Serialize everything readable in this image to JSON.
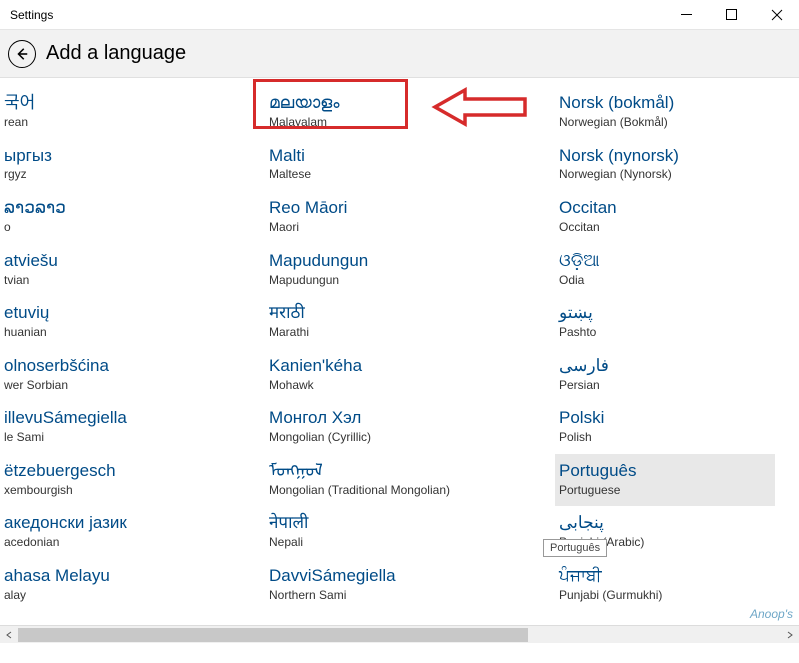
{
  "window": {
    "title": "Settings"
  },
  "header": {
    "page_title": "Add a language"
  },
  "tooltip": "Português",
  "watermark": "Anoop's",
  "columns": {
    "col1": [
      {
        "native": "국어",
        "english": "rean"
      },
      {
        "native": "ыргыз",
        "english": "rgyz"
      },
      {
        "native": "ລາວລາວ",
        "english": "o"
      },
      {
        "native": "atviešu",
        "english": "tvian"
      },
      {
        "native": "etuvių",
        "english": "huanian"
      },
      {
        "native": "olnoserbšćina",
        "english": "wer Sorbian"
      },
      {
        "native": "illevuSámegiella",
        "english": "le Sami"
      },
      {
        "native": "ëtzebuergesch",
        "english": "xembourgish"
      },
      {
        "native": "акедонски јазик",
        "english": "acedonian"
      },
      {
        "native": "ahasa Melayu",
        "english": "alay"
      }
    ],
    "col2": [
      {
        "native": "മലയാളം",
        "english": "Malayalam"
      },
      {
        "native": "Malti",
        "english": "Maltese"
      },
      {
        "native": "Reo Māori",
        "english": "Maori"
      },
      {
        "native": "Mapudungun",
        "english": "Mapudungun"
      },
      {
        "native": "मराठी",
        "english": "Marathi"
      },
      {
        "native": "Kanien'kéha",
        "english": "Mohawk"
      },
      {
        "native": "Монгол Хэл",
        "english": "Mongolian (Cyrillic)"
      },
      {
        "native": "ᠮᠣᠩᠭᠣᠯ",
        "english": "Mongolian (Traditional Mongolian)"
      },
      {
        "native": "नेपाली",
        "english": "Nepali"
      },
      {
        "native": "DavviSámegiella",
        "english": "Northern Sami"
      }
    ],
    "col3": [
      {
        "native": "Norsk (bokmål)",
        "english": "Norwegian (Bokmål)"
      },
      {
        "native": "Norsk (nynorsk)",
        "english": "Norwegian (Nynorsk)"
      },
      {
        "native": "Occitan",
        "english": "Occitan"
      },
      {
        "native": "ଓଡ଼ିଆ",
        "english": "Odia"
      },
      {
        "native": "پښتو",
        "english": "Pashto"
      },
      {
        "native": "فارسى",
        "english": "Persian"
      },
      {
        "native": "Polski",
        "english": "Polish"
      },
      {
        "native": "Português",
        "english": "Portuguese",
        "highlighted": true
      },
      {
        "native": "پنجابی",
        "english": "Punjabi (Arabic)"
      },
      {
        "native": "ਪੰਜਾਬੀ",
        "english": "Punjabi (Gurmukhi)"
      }
    ]
  }
}
